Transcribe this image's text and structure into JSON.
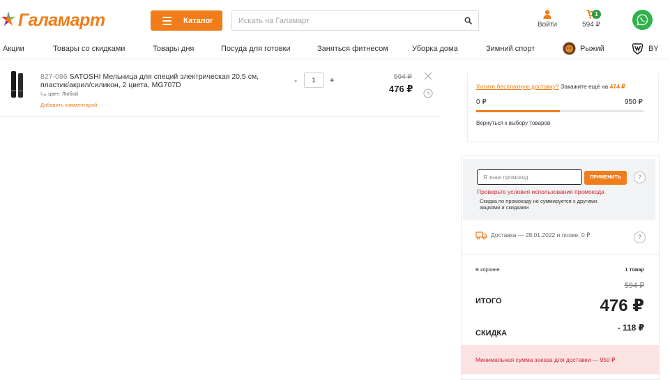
{
  "brand": {
    "logo_text": "Галамарт"
  },
  "header": {
    "catalog_label": "Каталог",
    "search_placeholder": "Искать на Галамарт",
    "login_label": "Войти",
    "cart_count": "1",
    "cart_total": "594 ₽"
  },
  "nav": {
    "items": [
      "Акции",
      "Товары со скидками",
      "Товары дня",
      "Посуда для готовки",
      "Заняться фитнесом",
      "Уборка дома",
      "Зимний спорт"
    ],
    "brand1": "Рыжий",
    "brand2": "BY"
  },
  "cart_item": {
    "code": "827-086",
    "title": "SATOSHI Мельница для специй электрическая 20,5 см, пластик/акрил/силикон, 2 цвета, MG707D",
    "variant": "цвет: Любой",
    "add_comment": "Добавить комментарий",
    "qty_minus": "-",
    "qty": "1",
    "qty_plus": "+",
    "old_price": "594 ₽",
    "price": "476 ₽"
  },
  "delivery_panel": {
    "free_delivery_link": "Хотите бесплатную доставку?",
    "order_more": "Закажите ещё на",
    "amount_left": "474 ₽",
    "progress_start": "0 ₽",
    "progress_end": "950 ₽",
    "progress_fraction": 0.5,
    "back_link": "Вернуться к выбору товаров"
  },
  "order_panel": {
    "promo_placeholder": "Я знаю промокод",
    "apply_label": "ПРИМЕНИТЬ",
    "promo_error": "Проверьте условия использования промокода",
    "promo_note": "Скидка по промокоду не суммируется с другими акциями и скидками",
    "delivery_text": "Доставка — 28.01.2022 и позже, 0 ₽",
    "help_symbol": "?",
    "in_cart_label": "В корзине",
    "in_cart_value": "1 товар",
    "sum_old": "594 ₽",
    "total_label": "ИТОГО",
    "total_value": "476 ₽",
    "discount_label": "СКИДКА",
    "discount_value": "- 118 ₽",
    "min_sum_note": "Минимальная сумма заказа для доставки — 950 ₽"
  },
  "colors": {
    "accent": "#f07d1a",
    "success": "#2e9d42",
    "error": "#d0252c",
    "whatsapp": "#2fb14b"
  }
}
